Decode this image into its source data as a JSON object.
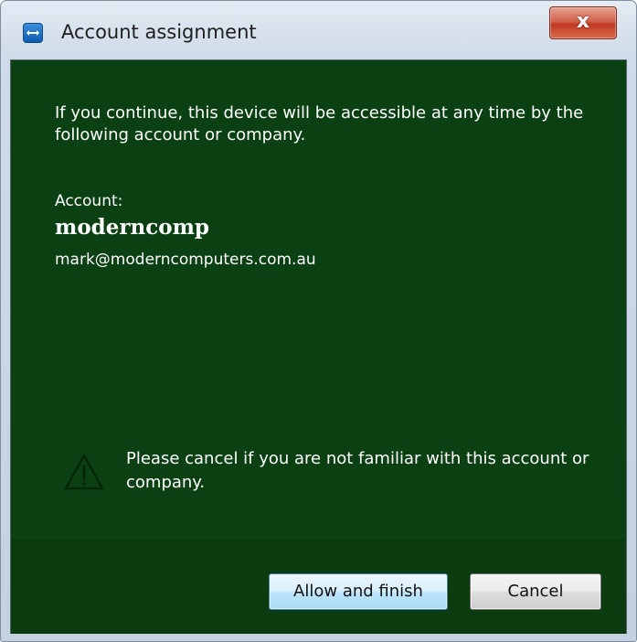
{
  "window": {
    "title": "Account assignment",
    "close_label": "x"
  },
  "message": {
    "info": "If you continue, this device will be accessible at any time by the following account or company.",
    "account_label": "Account:",
    "account_name": "moderncomp",
    "account_email": "mark@moderncomputers.com.au",
    "warning": "Please cancel if you are not familiar with this account or company."
  },
  "buttons": {
    "allow_label": "Allow and finish",
    "cancel_label": "Cancel"
  },
  "icons": {
    "app": "teamviewer-icon",
    "close": "close-icon",
    "warning": "warning-triangle-icon"
  },
  "colors": {
    "background": "#0b4012",
    "text": "#ffffff",
    "close_button": "#c8432b"
  }
}
